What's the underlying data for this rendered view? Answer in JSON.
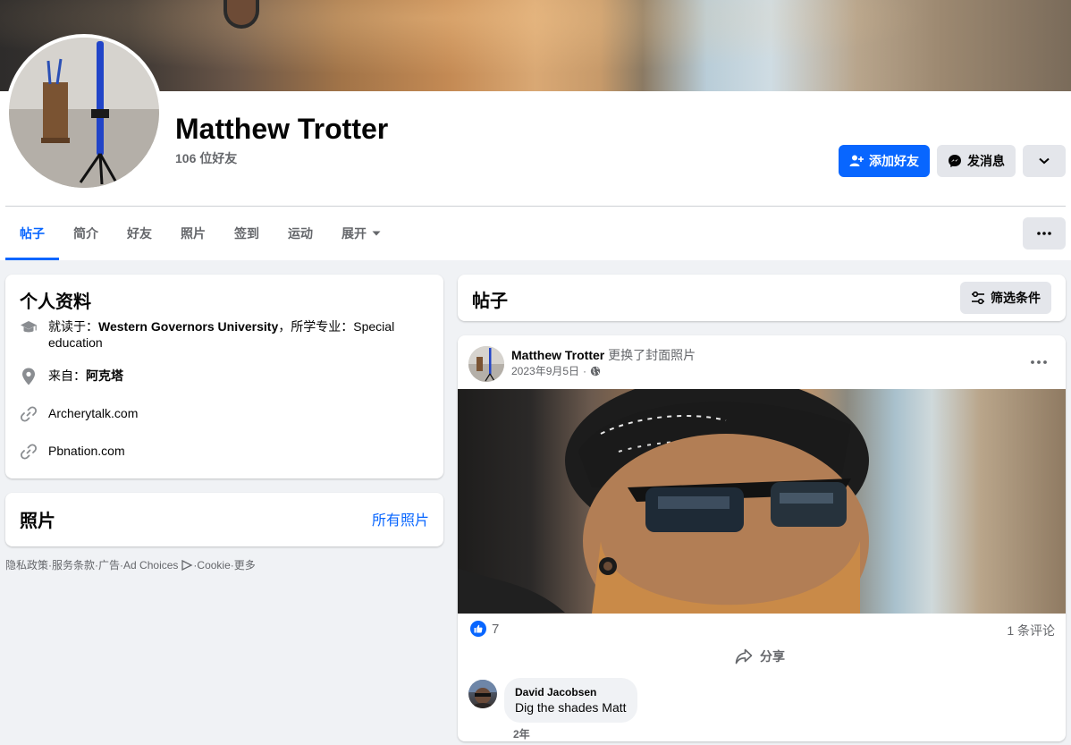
{
  "profile": {
    "name": "Matthew Trotter",
    "friends_count": "106 位好友"
  },
  "actions": {
    "add_friend": "添加好友",
    "message": "发消息"
  },
  "tabs": [
    {
      "label": "帖子",
      "active": true
    },
    {
      "label": "简介",
      "active": false
    },
    {
      "label": "好友",
      "active": false
    },
    {
      "label": "照片",
      "active": false
    },
    {
      "label": "签到",
      "active": false
    },
    {
      "label": "运动",
      "active": false
    },
    {
      "label": "展开",
      "active": false
    }
  ],
  "intro": {
    "title": "个人资料",
    "education_prefix": "就读于：",
    "education_school": "Western Governors University",
    "education_sep": "，所学专业：Special education",
    "from_prefix": "来自：",
    "from_place": "阿克塔",
    "link1": "Archerytalk.com",
    "link2": "Pbnation.com"
  },
  "photos": {
    "title": "照片",
    "all_photos": "所有照片"
  },
  "footer": {
    "privacy": "隐私政策",
    "terms": "服务条款",
    "ads": "广告",
    "ad_choices": "Ad Choices",
    "cookie": "Cookie",
    "more": "更多",
    "sep": " · "
  },
  "posts": {
    "title": "帖子",
    "filter": "筛选条件"
  },
  "post": {
    "author": "Matthew Trotter",
    "action": "更换了封面照片",
    "date": "2023年9月5日",
    "date_sep": "·",
    "like_count": "7",
    "comment_count": "1 条评论",
    "share": "分享"
  },
  "comment": {
    "author": "David Jacobsen",
    "text": "Dig the shades Matt",
    "time": "2年"
  },
  "colors": {
    "accent": "#0866ff",
    "background": "#f0f2f5",
    "secondary_text": "#65676b",
    "button_gray": "#e4e6eb"
  },
  "icons": {
    "education": "graduation-cap-icon",
    "location": "map-pin-icon",
    "link": "link-icon",
    "add_friend": "person-plus-icon",
    "message": "messenger-icon",
    "globe": "globe-icon",
    "like": "thumbs-up-icon",
    "share": "share-arrow-icon",
    "filter": "sliders-icon"
  }
}
